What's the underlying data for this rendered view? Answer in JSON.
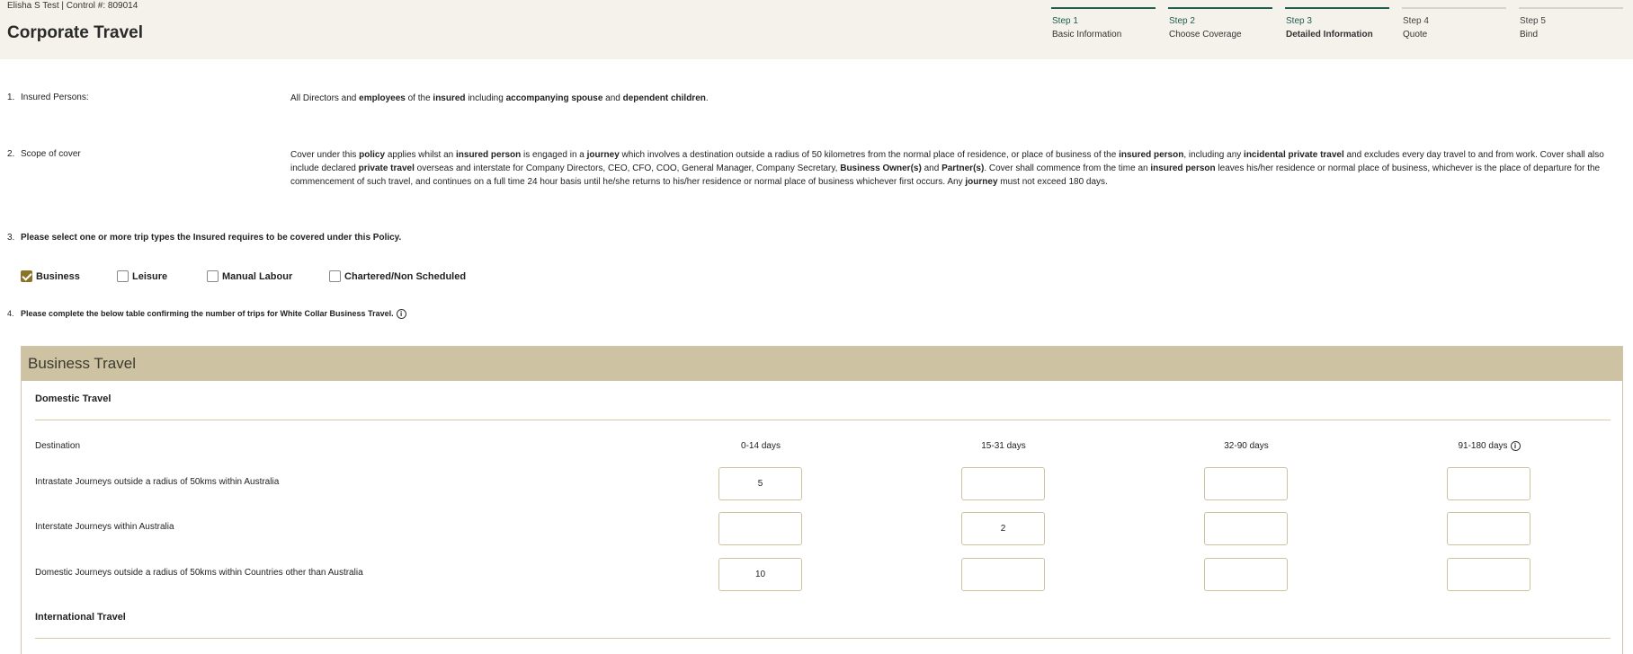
{
  "header": {
    "meta": "Elisha S Test | Control #: 809014",
    "title": "Corporate Travel"
  },
  "steps": [
    {
      "num": "Step 1",
      "label": "Basic Information",
      "state": "done"
    },
    {
      "num": "Step 2",
      "label": "Choose Coverage",
      "state": "done"
    },
    {
      "num": "Step 3",
      "label": "Detailed Information",
      "state": "current"
    },
    {
      "num": "Step 4",
      "label": "Quote",
      "state": "inactive"
    },
    {
      "num": "Step 5",
      "label": "Bind",
      "state": "inactive"
    }
  ],
  "questions": {
    "q1": {
      "num": "1.",
      "label": "Insured Persons:"
    },
    "q2": {
      "num": "2.",
      "label": "Scope of cover"
    },
    "q3": {
      "num": "3.",
      "label": "Please select one or more trip types the Insured requires to be covered under this Policy."
    },
    "q4": {
      "num": "4.",
      "label": "Please complete the below table confirming the number of trips for White Collar Business Travel."
    }
  },
  "trip_types": [
    {
      "label": "Business",
      "checked": true
    },
    {
      "label": "Leisure",
      "checked": false
    },
    {
      "label": "Manual Labour",
      "checked": false
    },
    {
      "label": "Chartered/Non Scheduled",
      "checked": false
    }
  ],
  "business_travel": {
    "title": "Business Travel",
    "domestic_title": "Domestic Travel",
    "international_title": "International Travel",
    "destination_header": "Destination",
    "columns": [
      "0-14 days",
      "15-31 days",
      "32-90 days",
      "91-180 days"
    ],
    "rows": [
      {
        "label": "Intrastate Journeys outside a radius of 50kms within Australia",
        "values": [
          "5",
          "",
          "",
          ""
        ]
      },
      {
        "label": "Interstate Journeys within Australia",
        "values": [
          "",
          "2",
          "",
          ""
        ]
      },
      {
        "label": "Domestic Journeys outside a radius of 50kms within Countries other than Australia",
        "values": [
          "10",
          "",
          "",
          ""
        ]
      }
    ]
  },
  "icons": {
    "info": "info-icon",
    "check": "check-icon"
  },
  "colors": {
    "accent": "#1f5c4f",
    "panel_header": "#cdc3a3",
    "checkbox_checked": "#8a7228",
    "header_bg": "#f5f2ec"
  }
}
